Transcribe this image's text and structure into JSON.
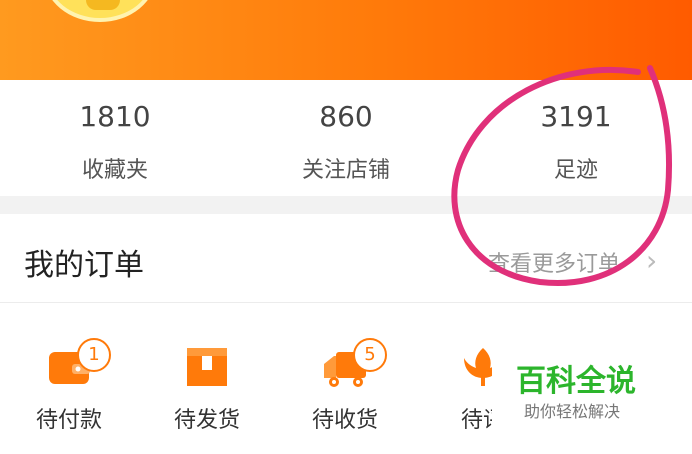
{
  "stats": [
    {
      "value": "1810",
      "label": "收藏夹"
    },
    {
      "value": "860",
      "label": "关注店铺"
    },
    {
      "value": "3191",
      "label": "足迹"
    }
  ],
  "orders": {
    "title": "我的订单",
    "more_label": "查看更多订单",
    "chevron": "›",
    "items": [
      {
        "label": "待付款",
        "badge": "1",
        "icon": "wallet-icon"
      },
      {
        "label": "待发货",
        "badge": "",
        "icon": "package-icon"
      },
      {
        "label": "待收货",
        "badge": "5",
        "icon": "truck-icon"
      },
      {
        "label": "待评",
        "badge": "",
        "icon": "review-icon"
      }
    ]
  },
  "watermark": {
    "title": "百科全说",
    "subtitle": "助你轻松解决"
  },
  "colors": {
    "accent": "#ff7a0a",
    "annotation": "#e0307a",
    "watermark": "#2cb52c"
  }
}
